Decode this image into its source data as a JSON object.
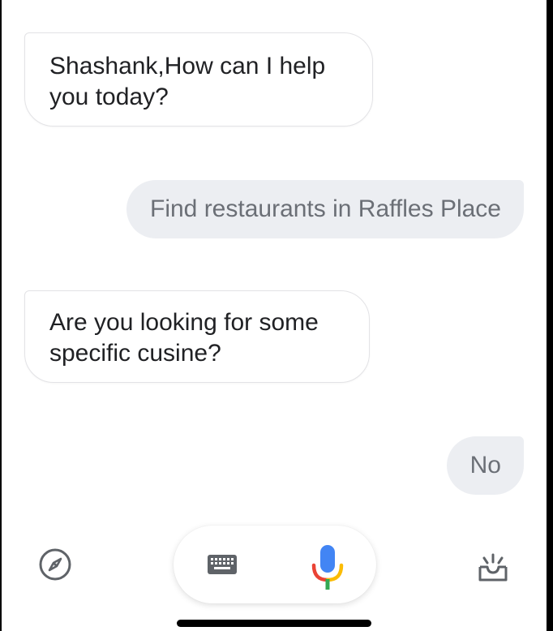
{
  "conversation": {
    "messages": [
      {
        "role": "assistant",
        "text": "Shashank,How can I help you today?"
      },
      {
        "role": "user",
        "text": "Find restaurants in Raffles Place"
      },
      {
        "role": "assistant",
        "text": "Are you looking for some specific cusine?"
      },
      {
        "role": "user",
        "text": "No"
      }
    ]
  },
  "bottom_bar": {
    "icons": {
      "explore": "compass-icon",
      "keyboard": "keyboard-icon",
      "mic": "microphone-icon",
      "snapshot": "snapshot-icon"
    }
  },
  "colors": {
    "assistant_bubble": "#ffffff",
    "user_bubble": "#eceef2",
    "user_text": "#6b6f76",
    "assistant_text": "#202124",
    "mic_blue": "#4285f4",
    "mic_red": "#ea4335",
    "mic_yellow": "#fbbc05",
    "mic_green": "#34a853"
  }
}
